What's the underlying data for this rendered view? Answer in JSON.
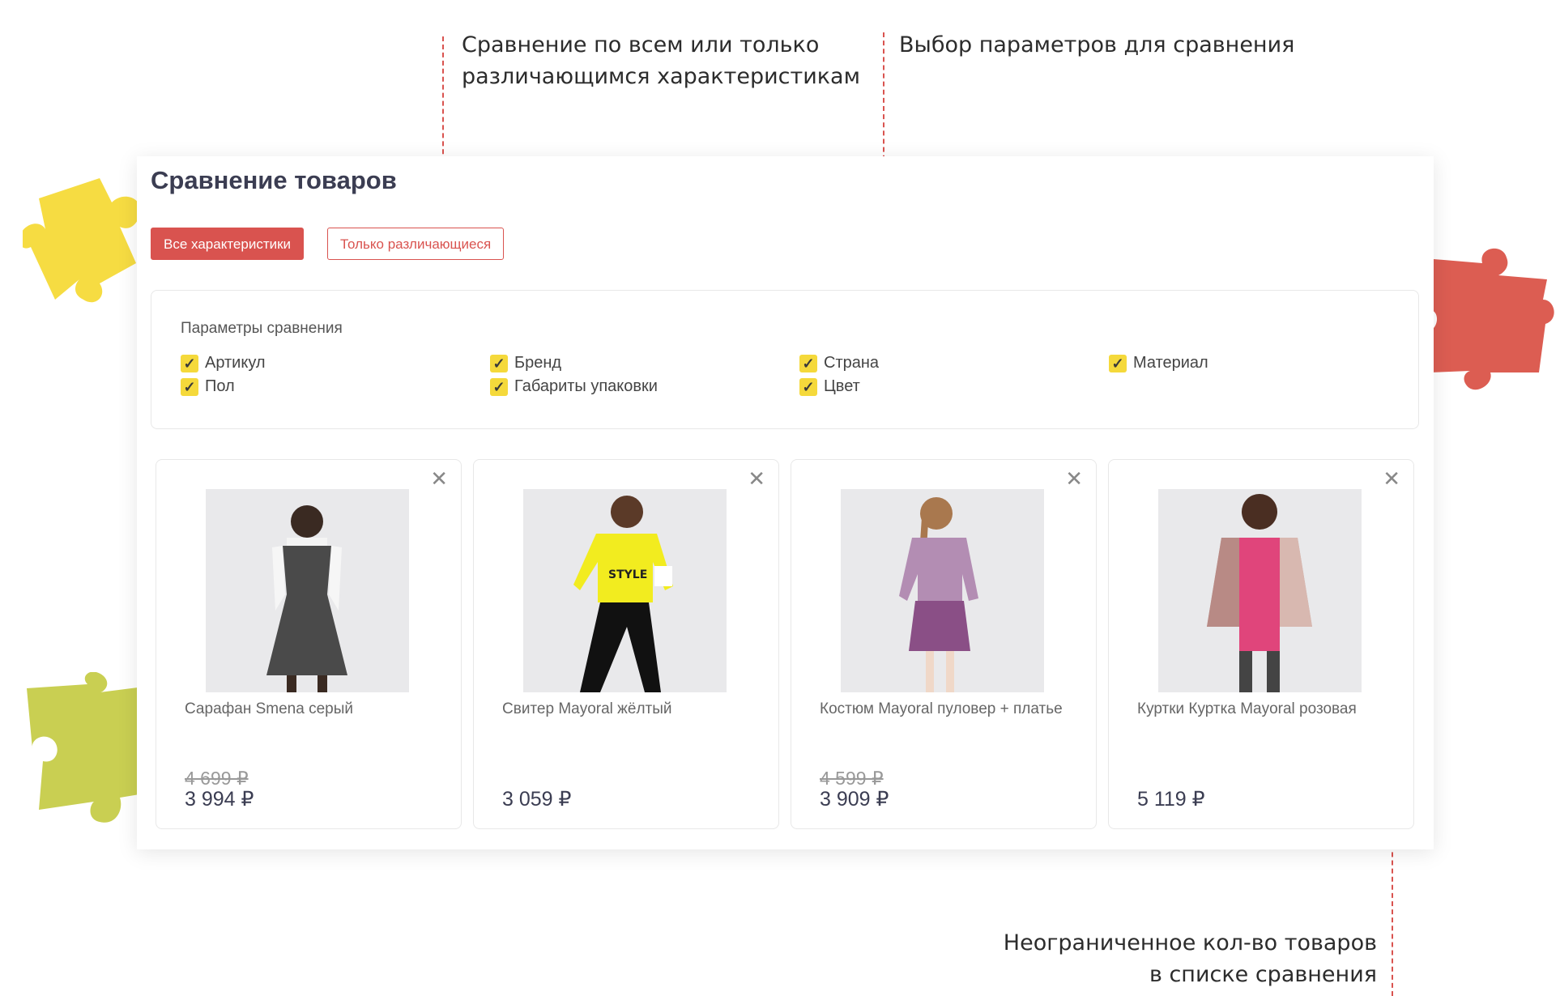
{
  "annotations": {
    "compare_mode": "Сравнение по всем или только\nразличающимся характеристикам",
    "param_select": "Выбор параметров для сравнения",
    "unlimited": "Неограниченное кол-во товаров\nв списке сравнения"
  },
  "page": {
    "title": "Сравнение товаров",
    "tabs": [
      "Все характеристики",
      "Только различающиеся"
    ]
  },
  "params": {
    "title": "Параметры сравнения",
    "items": [
      "Артикул",
      "Бренд",
      "Страна",
      "Материал",
      "Пол",
      "Габариты упаковки",
      "Цвет"
    ]
  },
  "products": [
    {
      "name": "Сарафан Smena серый",
      "old_price": "4 699 ₽",
      "price": "3 994 ₽"
    },
    {
      "name": "Свитер Mayoral жёлтый",
      "old_price": "",
      "price": "3 059 ₽"
    },
    {
      "name": "Костюм Mayoral пуловер + платье",
      "old_price": "4 599 ₽",
      "price": "3 909 ₽"
    },
    {
      "name": "Куртки Куртка Mayoral розовая",
      "old_price": "",
      "price": "5 119 ₽"
    }
  ],
  "colors": {
    "accent": "#d9534f",
    "checkbox": "#f5d93b",
    "puzzle_yellow": "#f6dc42",
    "puzzle_red": "#dc5d52",
    "puzzle_green": "#c9cf52"
  },
  "icons": {
    "close": "close-icon",
    "check": "check-icon"
  }
}
